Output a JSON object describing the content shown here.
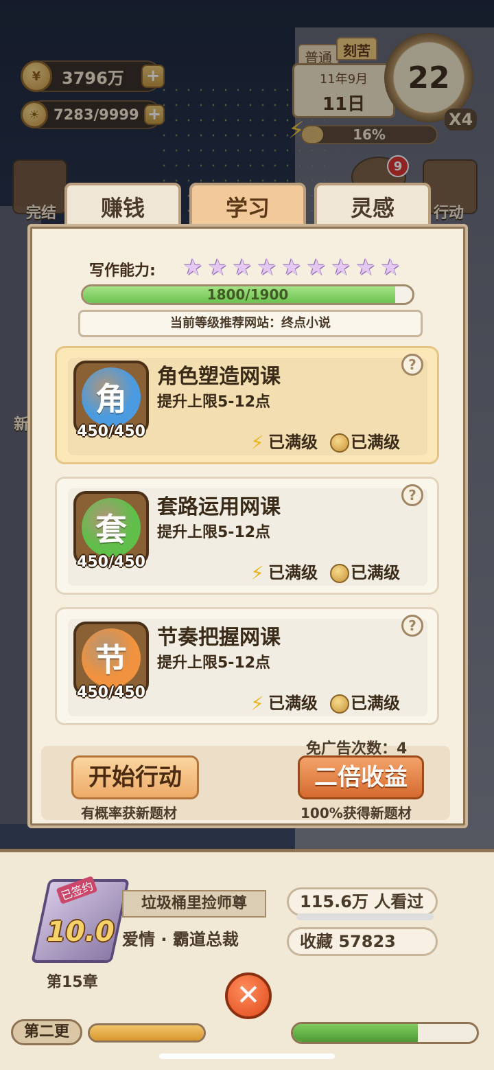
{
  "hud": {
    "coins": "3796万",
    "inspiration": "7283/9999",
    "mode_tabs": [
      "普通",
      "刻苦"
    ],
    "date_month": "11年9月",
    "date_day": "11日",
    "clock_value": "22",
    "multiplier": "X4",
    "energy_percent_text": "16%",
    "energy_percent": 0.16,
    "side_labels": {
      "left_top": "完结",
      "right_top": "行动",
      "left_mid": "新"
    },
    "notification_count": "9"
  },
  "panel": {
    "tabs": [
      {
        "label": "赚钱",
        "active": false
      },
      {
        "label": "学习",
        "active": true
      },
      {
        "label": "灵感",
        "active": false
      }
    ],
    "ability_label": "写作能力:",
    "stars": 9,
    "xp_text": "1800/1900",
    "xp_fraction": 0.947,
    "recommended_site": "当前等级推荐网站：终点小说",
    "courses": [
      {
        "icon_char": "角",
        "icon_color": "#4a9be0",
        "title": "角色塑造网课",
        "desc": "提升上限5-12点",
        "count": "450/450",
        "energy_status": "已满级",
        "coin_status": "已满级",
        "highlighted": true
      },
      {
        "icon_char": "套",
        "icon_color": "#5fbf4a",
        "title": "套路运用网课",
        "desc": "提升上限5-12点",
        "count": "450/450",
        "energy_status": "已满级",
        "coin_status": "已满级",
        "highlighted": false
      },
      {
        "icon_char": "节",
        "icon_color": "#f0923e",
        "title": "节奏把握网课",
        "desc": "提升上限5-12点",
        "count": "450/450",
        "energy_status": "已满级",
        "coin_status": "已满级",
        "highlighted": false
      }
    ],
    "free_ads": "免广告次数：4",
    "start_button": "开始行动",
    "start_sub": "有概率获新题材",
    "double_button": "二倍收益",
    "double_sub": "100%获得新题材"
  },
  "book": {
    "signed_tag": "已签约",
    "rating": "10.0",
    "chapter": "第15章",
    "title": "垃圾桶里捡师尊",
    "genre": "爱情 · 霸道总裁",
    "views": "115.6万  人看过",
    "views_fraction": 0.0,
    "favorites": "收藏  57823",
    "update_label": "第二更",
    "left_progress": 1.0,
    "right_progress": 0.68
  },
  "icons": {
    "coin": "coin-icon",
    "bulb": "bulb-icon",
    "bolt": "bolt-icon",
    "help": "help-icon",
    "close": "close-icon",
    "star": "star-icon"
  }
}
